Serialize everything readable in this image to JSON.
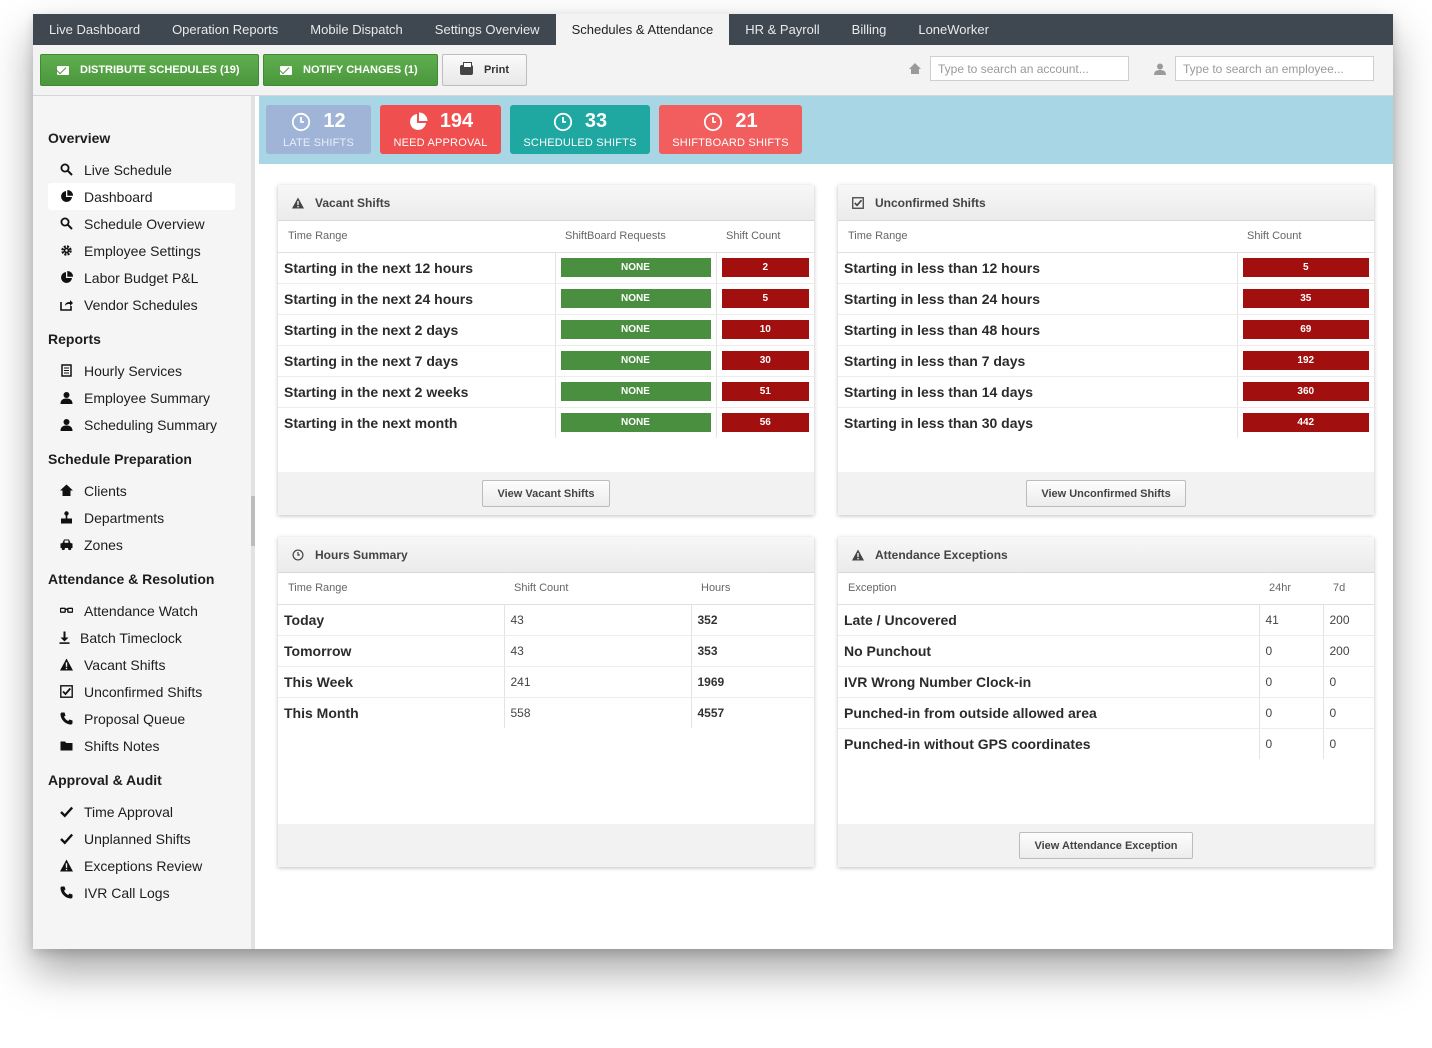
{
  "nav": {
    "tabs": [
      {
        "label": "Live Dashboard"
      },
      {
        "label": "Operation Reports"
      },
      {
        "label": "Mobile Dispatch"
      },
      {
        "label": "Settings Overview"
      },
      {
        "label": "Schedules & Attendance",
        "active": true
      },
      {
        "label": "HR & Payroll"
      },
      {
        "label": "Billing"
      },
      {
        "label": "LoneWorker"
      }
    ]
  },
  "toolbar": {
    "distribute_label": "DISTRIBUTE SCHEDULES (19)",
    "notify_label": "NOTIFY CHANGES (1)",
    "print_label": "Print",
    "account_search_placeholder": "Type to search an account...",
    "employee_search_placeholder": "Type to search an employee..."
  },
  "sidebar": {
    "sections": [
      {
        "title": "Overview",
        "items": [
          {
            "label": "Live Schedule",
            "icon": "search-icon"
          },
          {
            "label": "Dashboard",
            "icon": "pie-chart-icon",
            "active": true
          },
          {
            "label": "Schedule Overview",
            "icon": "search-icon"
          },
          {
            "label": "Employee Settings",
            "icon": "gear-icon"
          },
          {
            "label": "Labor Budget P&L",
            "icon": "pie-chart-icon"
          },
          {
            "label": "Vendor Schedules",
            "icon": "share-icon"
          }
        ]
      },
      {
        "title": "Reports",
        "items": [
          {
            "label": "Hourly Services",
            "icon": "document-icon"
          },
          {
            "label": "Employee Summary",
            "icon": "user-icon"
          },
          {
            "label": "Scheduling Summary",
            "icon": "user-icon"
          }
        ]
      },
      {
        "title": "Schedule Preparation",
        "items": [
          {
            "label": "Clients",
            "icon": "home-icon"
          },
          {
            "label": "Departments",
            "icon": "org-icon"
          },
          {
            "label": "Zones",
            "icon": "car-icon"
          }
        ]
      },
      {
        "title": "Attendance & Resolution",
        "items": [
          {
            "label": "Attendance Watch",
            "icon": "glasses-icon"
          },
          {
            "label": "Batch Timeclock",
            "icon": "download-icon"
          },
          {
            "label": "Vacant Shifts",
            "icon": "warning-icon"
          },
          {
            "label": "Unconfirmed Shifts",
            "icon": "checkbox-icon"
          },
          {
            "label": "Proposal Queue",
            "icon": "phone-icon"
          },
          {
            "label": "Shifts Notes",
            "icon": "folder-icon"
          }
        ]
      },
      {
        "title": "Approval & Audit",
        "items": [
          {
            "label": "Time Approval",
            "icon": "check-icon"
          },
          {
            "label": "Unplanned Shifts",
            "icon": "check-icon"
          },
          {
            "label": "Exceptions Review",
            "icon": "warning-icon"
          },
          {
            "label": "IVR Call Logs",
            "icon": "phone-icon"
          }
        ]
      }
    ]
  },
  "kpis": [
    {
      "value": "12",
      "label": "LATE SHIFTS",
      "color": "#9fb4d6",
      "icon": "clock-icon"
    },
    {
      "value": "194",
      "label": "NEED APPROVAL",
      "color": "#ef4f4f",
      "icon": "pie-chart-icon"
    },
    {
      "value": "33",
      "label": "SCHEDULED SHIFTS",
      "color": "#1fa8a1",
      "icon": "clock-icon"
    },
    {
      "value": "21",
      "label": "SHIFTBOARD SHIFTS",
      "color": "#f25e5e",
      "icon": "clock-icon"
    }
  ],
  "vacant": {
    "title": "Vacant Shifts",
    "headers": [
      "Time Range",
      "ShiftBoard Requests",
      "Shift Count"
    ],
    "rows": [
      {
        "range": "Starting in the next 12 hours",
        "requests": "NONE",
        "count": "2"
      },
      {
        "range": "Starting in the next 24 hours",
        "requests": "NONE",
        "count": "5"
      },
      {
        "range": "Starting in the next 2 days",
        "requests": "NONE",
        "count": "10"
      },
      {
        "range": "Starting in the next 7 days",
        "requests": "NONE",
        "count": "30"
      },
      {
        "range": "Starting in the next 2 weeks",
        "requests": "NONE",
        "count": "51"
      },
      {
        "range": "Starting in the next month",
        "requests": "NONE",
        "count": "56"
      }
    ],
    "button": "View Vacant Shifts"
  },
  "unconfirmed": {
    "title": "Unconfirmed Shifts",
    "headers": [
      "Time Range",
      "Shift Count"
    ],
    "rows": [
      {
        "range": "Starting in less than 12 hours",
        "count": "5"
      },
      {
        "range": "Starting in less than 24 hours",
        "count": "35"
      },
      {
        "range": "Starting in less than 48 hours",
        "count": "69"
      },
      {
        "range": "Starting in less than 7 days",
        "count": "192"
      },
      {
        "range": "Starting in less than 14 days",
        "count": "360"
      },
      {
        "range": "Starting in less than 30 days",
        "count": "442"
      }
    ],
    "button": "View Unconfirmed Shifts"
  },
  "hours": {
    "title": "Hours Summary",
    "headers": [
      "Time Range",
      "Shift Count",
      "Hours"
    ],
    "rows": [
      {
        "range": "Today",
        "count": "43",
        "hours": "352"
      },
      {
        "range": "Tomorrow",
        "count": "43",
        "hours": "353"
      },
      {
        "range": "This Week",
        "count": "241",
        "hours": "1969"
      },
      {
        "range": "This Month",
        "count": "558",
        "hours": "4557"
      }
    ]
  },
  "exceptions": {
    "title": "Attendance Exceptions",
    "headers": [
      "Exception",
      "24hr",
      "7d"
    ],
    "rows": [
      {
        "name": "Late / Uncovered",
        "d1": "41",
        "d7": "200"
      },
      {
        "name": "No Punchout",
        "d1": "0",
        "d7": "200"
      },
      {
        "name": "IVR Wrong Number Clock-in",
        "d1": "0",
        "d7": "0"
      },
      {
        "name": "Punched-in from outside allowed area",
        "d1": "0",
        "d7": "0"
      },
      {
        "name": "Punched-in without GPS coordinates",
        "d1": "0",
        "d7": "0"
      }
    ],
    "button": "View Attendance Exception"
  }
}
